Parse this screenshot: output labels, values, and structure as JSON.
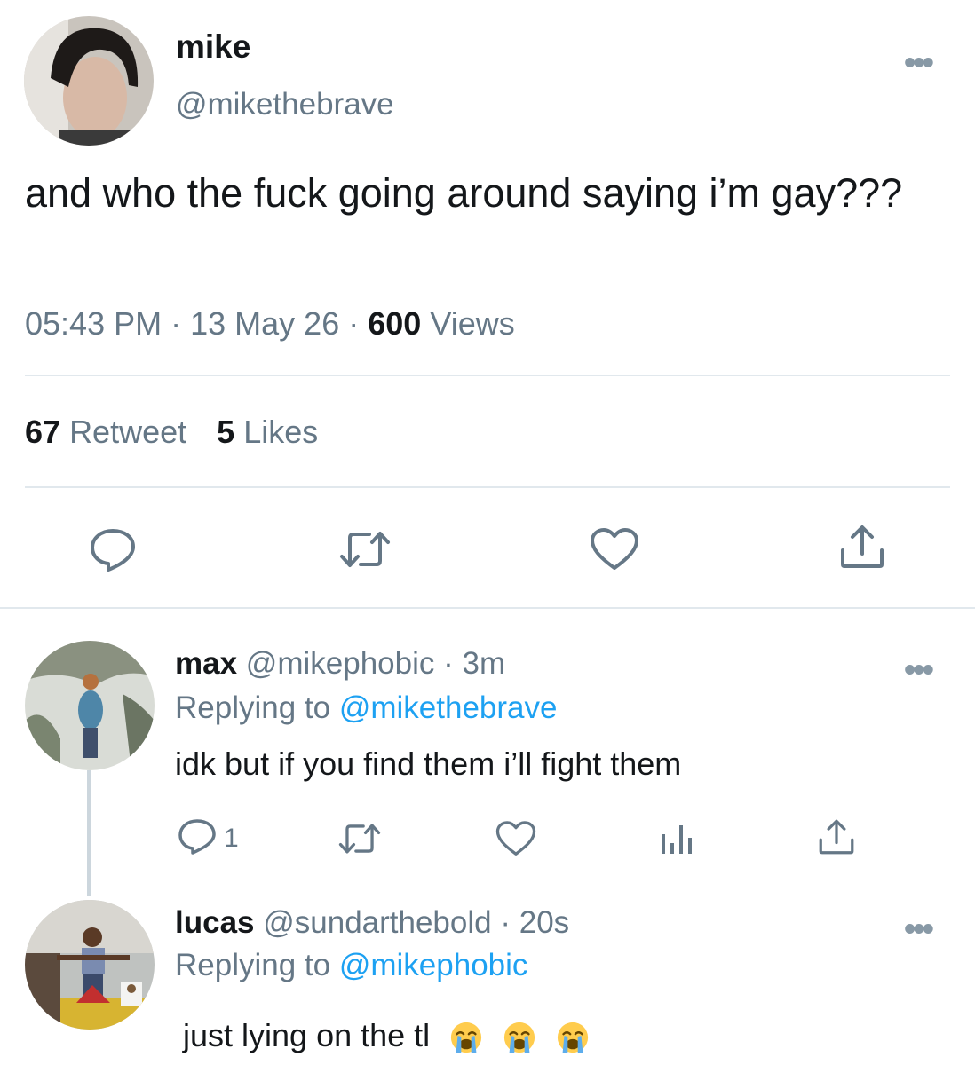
{
  "tweet": {
    "name": "mike",
    "handle": "@mikethebrave",
    "text": "and who the fuck going around saying i’m gay???",
    "time": "05:43 PM",
    "date": "13 May 26",
    "views_count": "600",
    "views_label": "Views",
    "retweet_count": "67",
    "retweet_label": "Retweet",
    "likes_count": "5",
    "likes_label": "Likes",
    "separator": "·",
    "more": "•••"
  },
  "replies": [
    {
      "name": "max",
      "handle": "@mikephobic",
      "time": "3m",
      "replying_label": "Replying to",
      "replying_to": "@mikethebrave",
      "text": "idk but if you find them i’ll fight them",
      "reply_count": "1"
    },
    {
      "name": "lucas",
      "handle": "@sundarthebold",
      "time": "20s",
      "replying_label": "Replying to",
      "replying_to": "@mikephobic",
      "text": "just lying on the tl"
    }
  ],
  "icons": {
    "reply": "reply-icon",
    "retweet": "retweet-icon",
    "like": "heart-icon",
    "share": "share-icon",
    "analytics": "analytics-icon",
    "more": "more-icon",
    "emoji": "loudly-crying-face-emoji"
  },
  "colors": {
    "text": "#14171a",
    "secondary": "#657786",
    "link": "#1da1f2",
    "divider": "#e1e8ed",
    "icon": "#657786"
  }
}
